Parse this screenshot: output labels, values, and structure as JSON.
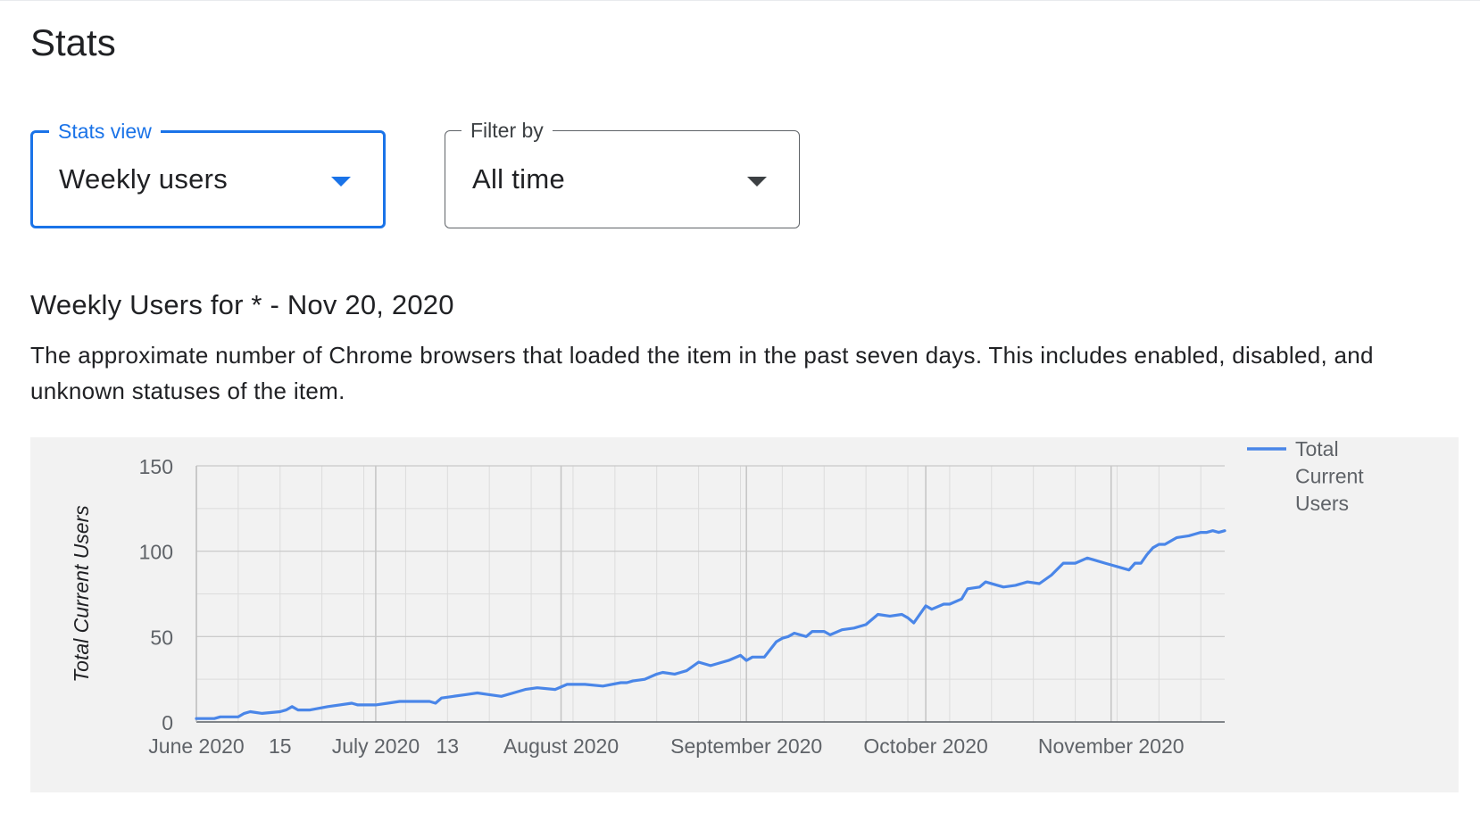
{
  "page": {
    "title": "Stats"
  },
  "stats_view": {
    "label": "Stats view",
    "value": "Weekly users"
  },
  "filter_by": {
    "label": "Filter by",
    "value": "All time"
  },
  "section": {
    "title": "Weekly Users for * - Nov 20, 2020",
    "description": "The approximate number of Chrome browsers that loaded the item in the past seven days. This includes enabled, disabled, and unknown statuses of the item."
  },
  "colors": {
    "accent": "#1a73e8",
    "line": "#4a86e8",
    "panel_bg": "#f2f2f2"
  },
  "icons": {
    "stats_view_dropdown": "arrow-drop-down-icon",
    "filter_by_dropdown": "arrow-drop-down-icon"
  },
  "chart_data": {
    "type": "line",
    "title": "",
    "xlabel": "",
    "ylabel": "Total Current Users",
    "ylim": [
      0,
      150
    ],
    "yticks": [
      0,
      50,
      100,
      150
    ],
    "xlim": [
      "2020-06-01",
      "2020-11-20"
    ],
    "xticks": [
      {
        "date": "2020-06-01",
        "label": "June 2020"
      },
      {
        "date": "2020-06-15",
        "label": "15"
      },
      {
        "date": "2020-07-01",
        "label": "July 2020"
      },
      {
        "date": "2020-07-13",
        "label": "13"
      },
      {
        "date": "2020-08-01",
        "label": "August 2020"
      },
      {
        "date": "2020-09-01",
        "label": "September 2020"
      },
      {
        "date": "2020-10-01",
        "label": "October 2020"
      },
      {
        "date": "2020-11-01",
        "label": "November 2020"
      }
    ],
    "grid": true,
    "legend_position": "right",
    "series": [
      {
        "name": "Total Current Users",
        "color": "#4a86e8",
        "x": [
          "2020-06-01",
          "2020-06-04",
          "2020-06-05",
          "2020-06-08",
          "2020-06-09",
          "2020-06-10",
          "2020-06-12",
          "2020-06-15",
          "2020-06-16",
          "2020-06-17",
          "2020-06-18",
          "2020-06-20",
          "2020-06-23",
          "2020-06-27",
          "2020-06-28",
          "2020-07-01",
          "2020-07-03",
          "2020-07-05",
          "2020-07-10",
          "2020-07-11",
          "2020-07-12",
          "2020-07-14",
          "2020-07-16",
          "2020-07-18",
          "2020-07-20",
          "2020-07-22",
          "2020-07-24",
          "2020-07-26",
          "2020-07-28",
          "2020-07-31",
          "2020-08-02",
          "2020-08-05",
          "2020-08-08",
          "2020-08-11",
          "2020-08-12",
          "2020-08-13",
          "2020-08-15",
          "2020-08-17",
          "2020-08-18",
          "2020-08-20",
          "2020-08-22",
          "2020-08-24",
          "2020-08-26",
          "2020-08-28",
          "2020-08-29",
          "2020-08-31",
          "2020-09-01",
          "2020-09-02",
          "2020-09-04",
          "2020-09-06",
          "2020-09-07",
          "2020-09-08",
          "2020-09-09",
          "2020-09-11",
          "2020-09-12",
          "2020-09-14",
          "2020-09-15",
          "2020-09-17",
          "2020-09-19",
          "2020-09-21",
          "2020-09-23",
          "2020-09-25",
          "2020-09-27",
          "2020-09-28",
          "2020-09-29",
          "2020-10-01",
          "2020-10-02",
          "2020-10-04",
          "2020-10-05",
          "2020-10-07",
          "2020-10-08",
          "2020-10-10",
          "2020-10-11",
          "2020-10-13",
          "2020-10-14",
          "2020-10-16",
          "2020-10-18",
          "2020-10-20",
          "2020-10-22",
          "2020-10-24",
          "2020-10-26",
          "2020-10-28",
          "2020-10-29",
          "2020-10-31",
          "2020-11-01",
          "2020-11-03",
          "2020-11-04",
          "2020-11-05",
          "2020-11-06",
          "2020-11-07",
          "2020-11-08",
          "2020-11-09",
          "2020-11-10",
          "2020-11-12",
          "2020-11-14",
          "2020-11-15",
          "2020-11-16",
          "2020-11-17",
          "2020-11-18",
          "2020-11-19",
          "2020-11-20"
        ],
        "y": [
          2,
          2,
          3,
          3,
          5,
          6,
          5,
          6,
          7,
          9,
          7,
          7,
          9,
          11,
          10,
          10,
          11,
          12,
          12,
          11,
          14,
          15,
          16,
          17,
          16,
          15,
          17,
          19,
          20,
          19,
          22,
          22,
          21,
          23,
          23,
          24,
          25,
          28,
          29,
          28,
          30,
          35,
          33,
          35,
          36,
          39,
          36,
          38,
          38,
          47,
          49,
          50,
          52,
          50,
          53,
          53,
          51,
          54,
          55,
          57,
          63,
          62,
          63,
          61,
          58,
          68,
          66,
          69,
          69,
          72,
          78,
          79,
          82,
          80,
          79,
          80,
          82,
          81,
          86,
          93,
          93,
          96,
          95,
          93,
          92,
          90,
          89,
          93,
          93,
          98,
          102,
          104,
          104,
          108,
          109,
          110,
          111,
          111,
          112,
          111,
          112
        ]
      }
    ],
    "legend": [
      "Total",
      "Current",
      "Users"
    ]
  }
}
